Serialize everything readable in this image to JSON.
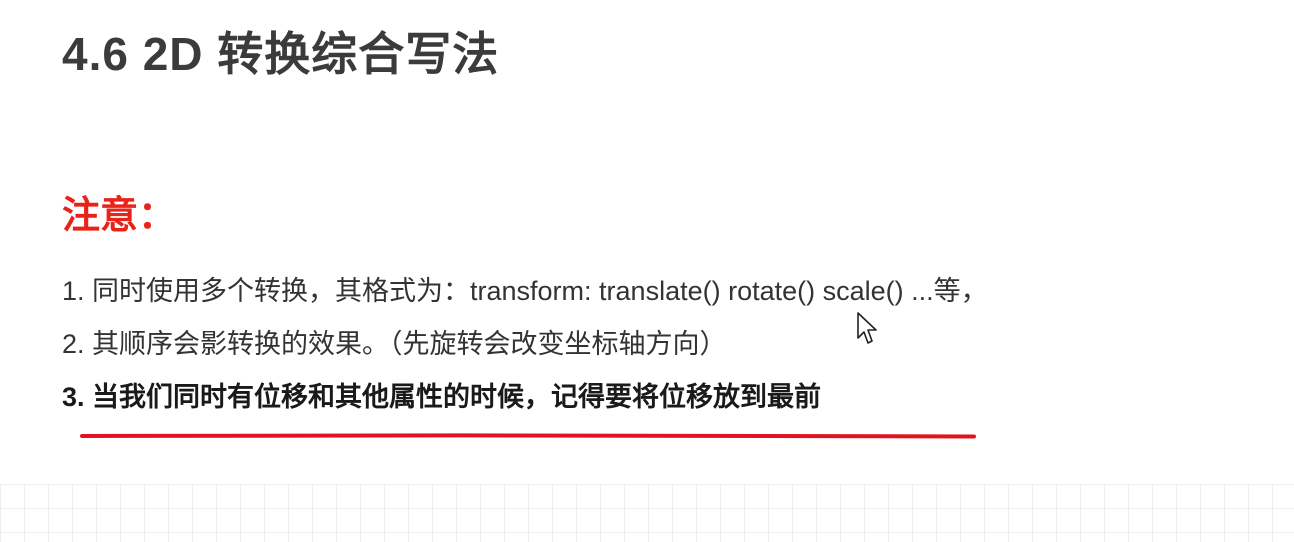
{
  "slide": {
    "title": "4.6 2D 转换综合写法",
    "note_heading": "注意：",
    "notes": [
      "1. 同时使用多个转换，其格式为：transform: translate() rotate() scale() ...等，",
      "2. 其顺序会影转换的效果。（先旋转会改变坐标轴方向）",
      "3. 当我们同时有位移和其他属性的时候，记得要将位移放到最前"
    ]
  },
  "colors": {
    "heading_red": "#e8231a",
    "underline_red": "#e0141e",
    "title_gray": "#3b3b3b"
  },
  "icons": {
    "cursor": "mouse-pointer-icon"
  }
}
